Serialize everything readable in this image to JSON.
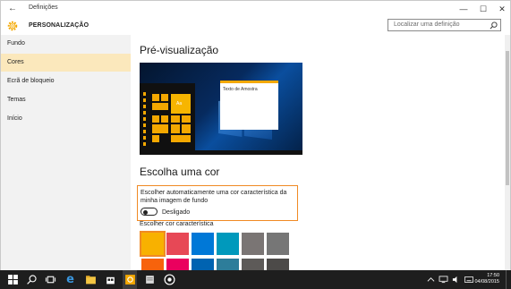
{
  "window": {
    "app_title": "Definições",
    "back_icon": "back-arrow-icon",
    "minimize_glyph": "—",
    "maximize_glyph": "☐",
    "close_glyph": "✕"
  },
  "header": {
    "title": "PERSONALIZAÇÃO",
    "icon": "gear-icon",
    "search_placeholder": "Localizar uma definição"
  },
  "sidebar": {
    "items": [
      {
        "label": "Fundo",
        "active": false
      },
      {
        "label": "Cores",
        "active": true
      },
      {
        "label": "Ecrã de bloqueio",
        "active": false
      },
      {
        "label": "Temas",
        "active": false
      },
      {
        "label": "Início",
        "active": false
      }
    ]
  },
  "main": {
    "preview_heading": "Pré-visualização",
    "preview_sample_text": "Texto de Amostra",
    "preview_tile_label": "Aa",
    "choose_color_heading": "Escolha uma cor",
    "auto_color_label": "Escolher automaticamente uma cor característica da minha imagem de fundo",
    "auto_color_state": "Desligado",
    "accent_label": "Escolher cor característica",
    "swatches": [
      {
        "color": "#f8b100",
        "selected": true
      },
      {
        "color": "#e74856",
        "selected": false
      },
      {
        "color": "#0078d7",
        "selected": false
      },
      {
        "color": "#0099bc",
        "selected": false
      },
      {
        "color": "#7a7574",
        "selected": false
      },
      {
        "color": "#767676",
        "selected": false
      }
    ],
    "swatches_row2": [
      "#f7630c",
      "#ea005e",
      "#0063b1",
      "#2d7d9a",
      "#5d5a58",
      "#4c4a48"
    ]
  },
  "accent_color": "#f4a800",
  "highlight_color": "#f08a24",
  "taskbar": {
    "time": "17:50",
    "date": "04/08/2015",
    "icons": [
      "windows-start-icon",
      "search-icon",
      "task-view-icon",
      "edge-icon",
      "file-explorer-icon",
      "store-icon",
      "settings-icon",
      "notes-icon",
      "media-icon"
    ]
  }
}
